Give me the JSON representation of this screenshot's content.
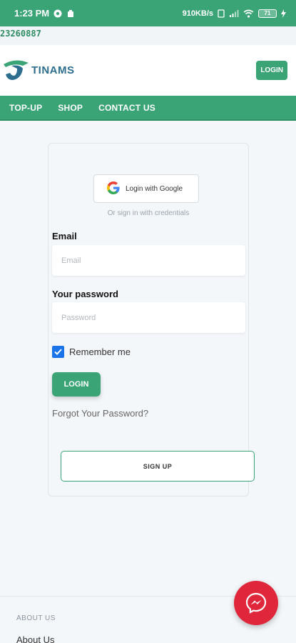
{
  "status_bar": {
    "time": "1:23 PM",
    "speed": "910KB/s",
    "battery": "71"
  },
  "ticker": {
    "text": "23260887"
  },
  "header": {
    "logo_text": "TINAMS",
    "login_label": "LOGIN"
  },
  "nav": {
    "items": [
      {
        "label": "TOP-UP"
      },
      {
        "label": "SHOP"
      },
      {
        "label": "CONTACT US"
      }
    ]
  },
  "form": {
    "google_label": "Login with Google",
    "or_text": "Or sign in with credentials",
    "email_label": "Email",
    "email_placeholder": "Email",
    "password_label": "Your password",
    "password_placeholder": "Password",
    "remember_label": "Remember me",
    "remember_checked": true,
    "login_label": "LOGIN",
    "forgot_label": "Forgot Your Password?",
    "signup_label": "SIGN UP"
  },
  "footer": {
    "heading": "ABOUT US",
    "link": "About Us"
  },
  "colors": {
    "brand_green": "#3aa476",
    "messenger_red": "#e0263a",
    "checkbox_blue": "#1a73e8"
  }
}
